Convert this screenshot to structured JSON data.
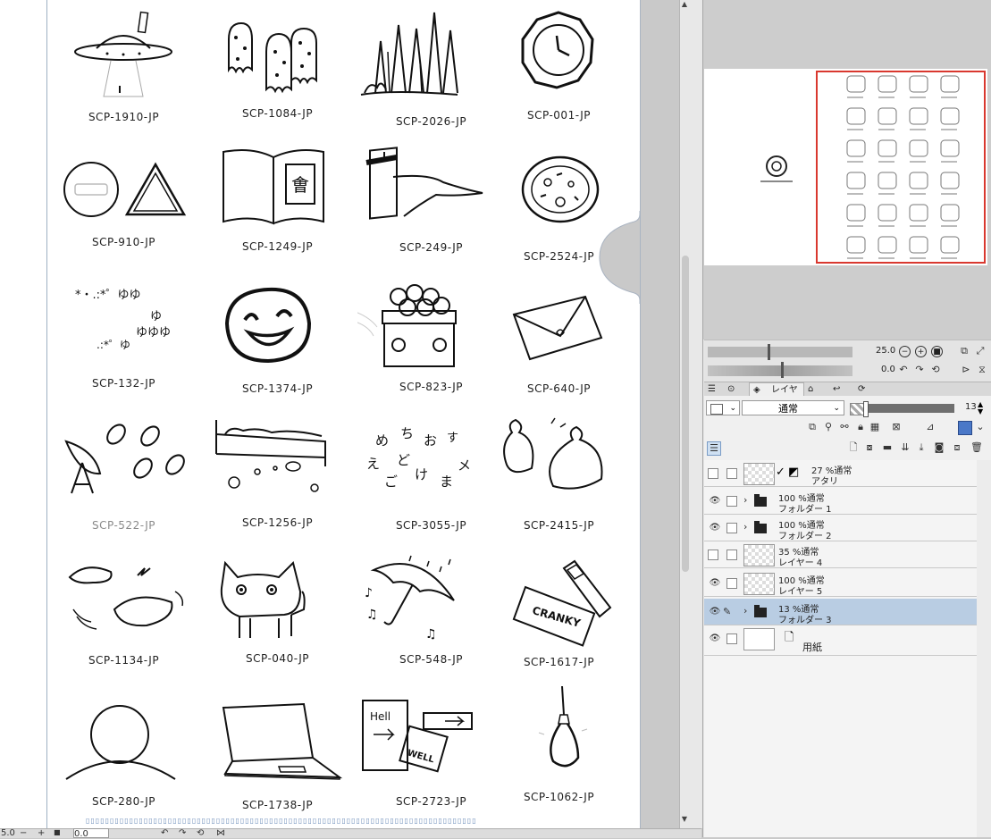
{
  "canvas": {
    "cells": [
      {
        "label": "SCP-1910-JP",
        "icon": "ufo-icon",
        "dim": false
      },
      {
        "label": "SCP-1084-JP",
        "icon": "ghosts-icon",
        "dim": false
      },
      {
        "label": "SCP-2026-JP",
        "icon": "spires-icon",
        "dim": false
      },
      {
        "label": "SCP-001-JP",
        "icon": "clock-icon",
        "dim": false
      },
      {
        "label": "SCP-910-JP",
        "icon": "signs-icon",
        "dim": false
      },
      {
        "label": "SCP-1249-JP",
        "icon": "book-icon",
        "dim": false
      },
      {
        "label": "SCP-249-JP",
        "icon": "calendar-icon",
        "dim": false
      },
      {
        "label": "SCP-2524-JP",
        "icon": "pizza-icon",
        "dim": false
      },
      {
        "label": "SCP-132-JP",
        "icon": "yu-letters-icon",
        "dim": false
      },
      {
        "label": "SCP-1374-JP",
        "icon": "smiley-icon",
        "dim": false
      },
      {
        "label": "SCP-823-JP",
        "icon": "dango-box-icon",
        "dim": false
      },
      {
        "label": "SCP-640-JP",
        "icon": "envelope-icon",
        "dim": false
      },
      {
        "label": "SCP-522-JP",
        "icon": "satellite-icon",
        "dim": true
      },
      {
        "label": "SCP-1256-JP",
        "icon": "bed-icon",
        "dim": false
      },
      {
        "label": "SCP-3055-JP",
        "icon": "kana-icon",
        "dim": false
      },
      {
        "label": "SCP-2415-JP",
        "icon": "bags-icon",
        "dim": false
      },
      {
        "label": "SCP-1134-JP",
        "icon": "sushi-icon",
        "dim": false
      },
      {
        "label": "SCP-040-JP",
        "icon": "cat-icon",
        "dim": false
      },
      {
        "label": "SCP-548-JP",
        "icon": "umbrella-icon",
        "dim": false
      },
      {
        "label": "SCP-1617-JP",
        "icon": "cranky-icon",
        "dim": false
      },
      {
        "label": "SCP-280-JP",
        "icon": "sphere-icon",
        "dim": false
      },
      {
        "label": "SCP-1738-JP",
        "icon": "laptop-icon",
        "dim": false
      },
      {
        "label": "SCP-2723-JP",
        "icon": "hell-sign-icon",
        "dim": false
      },
      {
        "label": "SCP-1062-JP",
        "icon": "noose-icon",
        "dim": false
      }
    ],
    "yu_text": {
      "l1": "*・.:*゜ゆゆ",
      "l2": "ゆ",
      "l3": "ゆゆゆ",
      "l4": ".:*゜ゆ"
    },
    "kana_text": {
      "a": "め",
      "b": "ち",
      "c": "お",
      "d": "え",
      "e": "ど",
      "f": "ご",
      "g": "け",
      "h": "ま",
      "i": "す",
      "j": "メ"
    },
    "cranky_text": "CRANKY",
    "hell_text": "Hell",
    "well_text": "WELL"
  },
  "bottom_bar": {
    "zoom_value": "5.0",
    "minus": "−",
    "plus": "+",
    "angle_value": "0.0"
  },
  "navigator": {
    "zoom_value": "25.0",
    "rotation_value": "0.0"
  },
  "layer_panel": {
    "tab_label": "レイヤー",
    "blend_mode": "通常",
    "opacity_value": "13",
    "layers": [
      {
        "opacity_mode": "27 %通常",
        "name": "アタリ",
        "type": "raster",
        "visible": false,
        "selected": false,
        "editing": false
      },
      {
        "opacity_mode": "100 %通常",
        "name": "フォルダー 1",
        "type": "folder",
        "visible": true,
        "selected": false,
        "editing": false
      },
      {
        "opacity_mode": "100 %通常",
        "name": "フォルダー 2",
        "type": "folder",
        "visible": true,
        "selected": false,
        "editing": false
      },
      {
        "opacity_mode": "35 %通常",
        "name": "レイヤー 4",
        "type": "raster",
        "visible": false,
        "selected": false,
        "editing": false
      },
      {
        "opacity_mode": "100 %通常",
        "name": "レイヤー 5",
        "type": "raster",
        "visible": true,
        "selected": false,
        "editing": false
      },
      {
        "opacity_mode": "13 %通常",
        "name": "フォルダー 3",
        "type": "folder",
        "visible": true,
        "selected": true,
        "editing": true
      },
      {
        "opacity_mode": "",
        "name": "用紙",
        "type": "paper",
        "visible": true,
        "selected": false,
        "editing": false
      }
    ]
  },
  "icons": {
    "eye": "eye-icon",
    "folder": "folder-icon",
    "pen": "pen-icon",
    "caret": "chevron-right-icon"
  },
  "colors": {
    "nav_frame": "#d9382f",
    "selection": "#b9cde3",
    "scroll_accent": "#6a8bb8"
  }
}
